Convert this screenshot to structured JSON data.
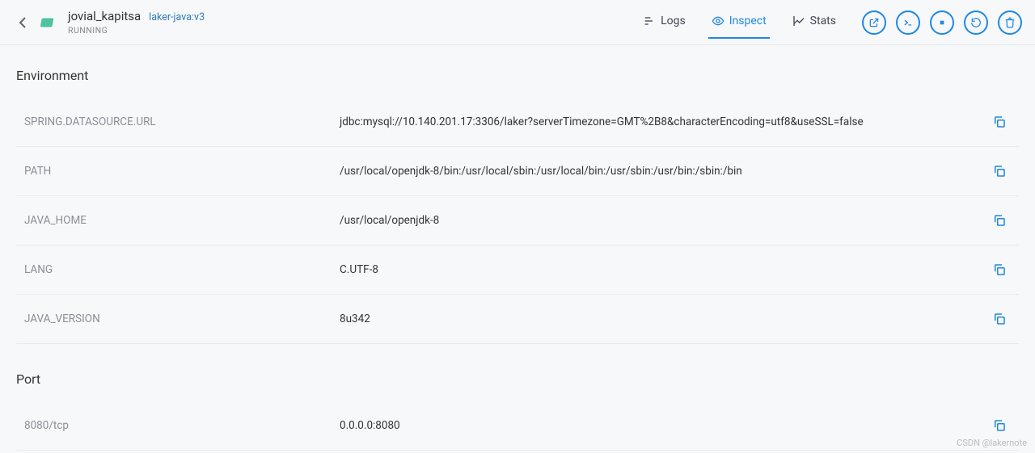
{
  "header": {
    "container_name": "jovial_kapitsa",
    "image_name": "laker-java:v3",
    "status": "RUNNING"
  },
  "tabs": {
    "logs": "Logs",
    "inspect": "Inspect",
    "stats": "Stats",
    "active": "inspect"
  },
  "sections": {
    "environment_title": "Environment",
    "port_title": "Port"
  },
  "environment": [
    {
      "key": "SPRING.DATASOURCE.URL",
      "value": "jdbc:mysql://10.140.201.17:3306/laker?serverTimezone=GMT%2B8&characterEncoding=utf8&useSSL=false"
    },
    {
      "key": "PATH",
      "value": "/usr/local/openjdk-8/bin:/usr/local/sbin:/usr/local/bin:/usr/sbin:/usr/bin:/sbin:/bin"
    },
    {
      "key": "JAVA_HOME",
      "value": "/usr/local/openjdk-8"
    },
    {
      "key": "LANG",
      "value": "C.UTF-8"
    },
    {
      "key": "JAVA_VERSION",
      "value": "8u342"
    }
  ],
  "ports": [
    {
      "key": "8080/tcp",
      "value": "0.0.0.0:8080"
    }
  ],
  "watermark": "CSDN @lakernote"
}
